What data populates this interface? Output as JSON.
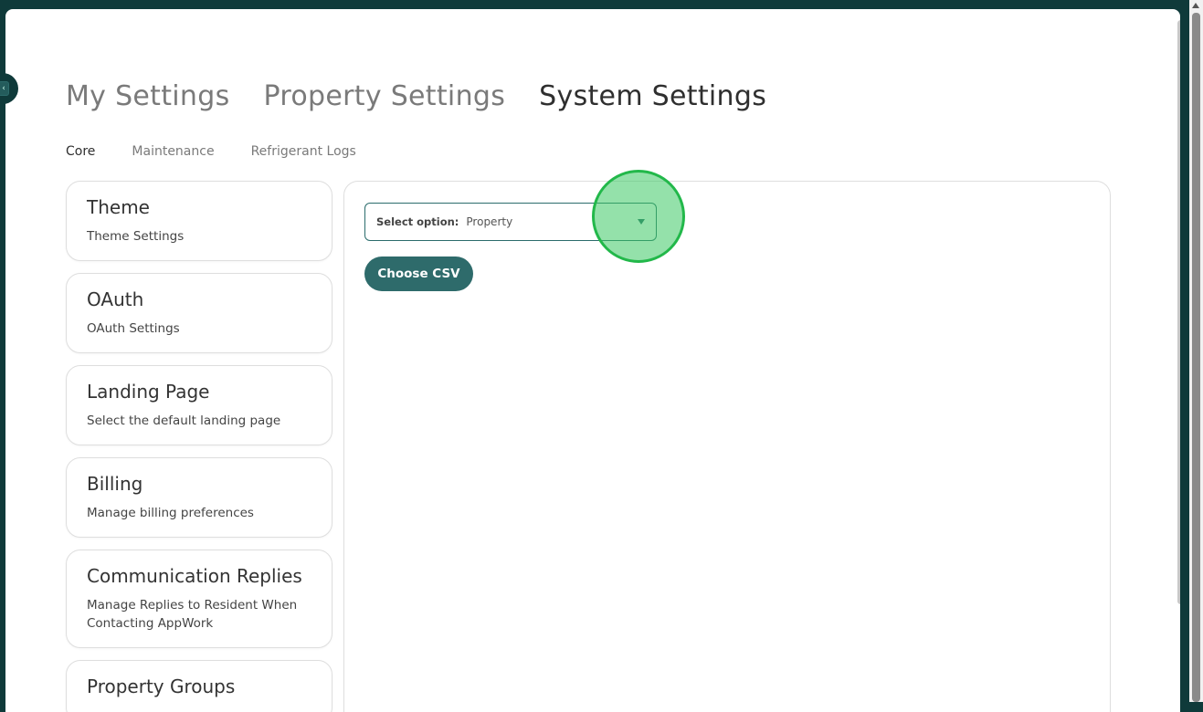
{
  "top_tabs": [
    {
      "label": "My Settings",
      "active": false
    },
    {
      "label": "Property Settings",
      "active": false
    },
    {
      "label": "System Settings",
      "active": true
    }
  ],
  "sub_tabs": [
    {
      "label": "Core",
      "active": true
    },
    {
      "label": "Maintenance",
      "active": false
    },
    {
      "label": "Refrigerant Logs",
      "active": false
    }
  ],
  "cards": [
    {
      "title": "Theme",
      "desc": "Theme Settings"
    },
    {
      "title": "OAuth",
      "desc": "OAuth Settings"
    },
    {
      "title": "Landing Page",
      "desc": "Select the default landing page"
    },
    {
      "title": "Billing",
      "desc": "Manage billing preferences"
    },
    {
      "title": "Communication Replies",
      "desc": "Manage Replies to Resident When Contacting AppWork"
    },
    {
      "title": "Property Groups",
      "desc": ""
    }
  ],
  "panel": {
    "select_label": "Select option:",
    "select_value": "Property",
    "choose_csv_label": "Choose CSV"
  },
  "icons": {
    "collapse": "chevron-left-icon",
    "select": "caret-down-icon"
  },
  "colors": {
    "brand": "#2e6b6b",
    "frame": "#0f3a3a",
    "click_indicator": "#22b84a"
  }
}
